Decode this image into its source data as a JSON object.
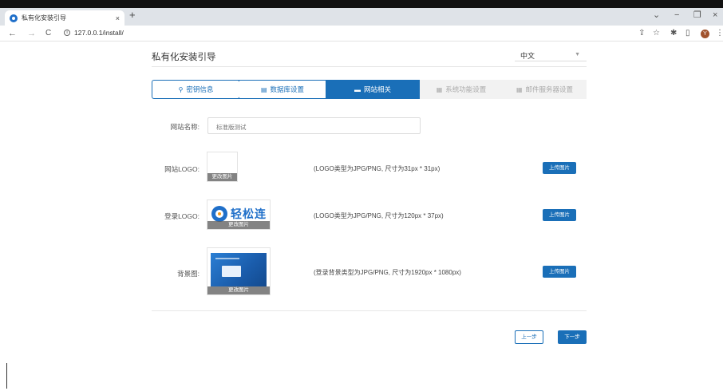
{
  "browser": {
    "tab_title": "私有化安装引导",
    "tab_close": "×",
    "new_tab": "+",
    "url": "127.0.0.1/install/",
    "nav_back": "←",
    "nav_forward": "→",
    "nav_reload": "C",
    "avatar_letter": "Y",
    "win_minimize": "−",
    "win_restore": "❐",
    "win_close": "×",
    "tab_search": "⌄"
  },
  "header": {
    "title": "私有化安装引导",
    "language": "中文"
  },
  "steps": [
    {
      "label": "密钥信息",
      "icon": "key-icon",
      "state": "done"
    },
    {
      "label": "数据库设置",
      "icon": "database-icon",
      "state": "done"
    },
    {
      "label": "网站相关",
      "icon": "monitor-icon",
      "state": "active"
    },
    {
      "label": "系统功能设置",
      "icon": "grid-icon",
      "state": "pending"
    },
    {
      "label": "邮件服务器设置",
      "icon": "grid-icon",
      "state": "pending"
    }
  ],
  "form": {
    "site_name_label": "网站名称:",
    "site_name_value": "标准版测试",
    "site_logo_label": "网站LOGO:",
    "site_logo_hint": "(LOGO类型为JPG/PNG, 尺寸为31px * 31px)",
    "login_logo_label": "登录LOGO:",
    "login_logo_hint": "(LOGO类型为JPG/PNG, 尺寸为120px * 37px)",
    "login_logo_text": "轻松连",
    "background_label": "背景图:",
    "background_hint": "(登录背景类型为JPG/PNG, 尺寸为1920px * 1080px)",
    "change_image": "更改图片",
    "upload_button": "上传图片"
  },
  "footer": {
    "prev_label": "上一步",
    "next_label": "下一步"
  },
  "colors": {
    "accent": "#1a6fb8",
    "pending_bg": "#f2f2f2"
  }
}
